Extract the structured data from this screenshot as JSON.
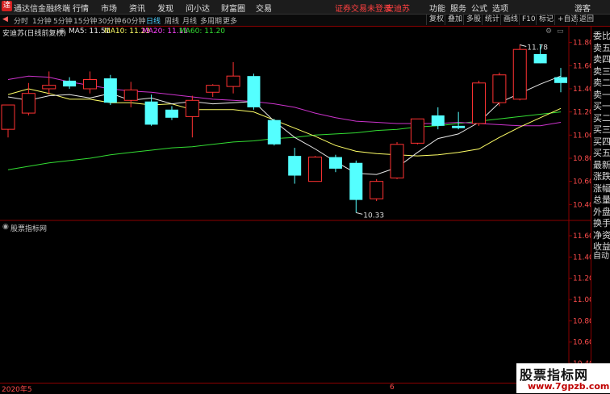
{
  "titlebar": {
    "app_name": "通达信金融终端",
    "menus": [
      "行情",
      "市场",
      "资讯",
      "发现",
      "问小达",
      "财富圈",
      "交易"
    ],
    "notice": "证券交易未登录",
    "stock_link": "安迪苏",
    "right": [
      "功能",
      "服务",
      "公式",
      "选项"
    ],
    "guest": "游客"
  },
  "toolbar": {
    "periods": [
      "分时",
      "1分钟",
      "5分钟",
      "15分钟",
      "30分钟",
      "60分钟",
      "日线",
      "周线",
      "月线",
      "多周期",
      "更多"
    ],
    "active_period": "日线",
    "buttons": [
      "复权",
      "叠加",
      "多股",
      "统计",
      "画线",
      "F10",
      "标记",
      "+自选",
      "返回"
    ]
  },
  "chart_title": "安迪苏(日线前复权)",
  "ma_legend": [
    {
      "label": "MA5: 11.51",
      "color": "#e8e8e8"
    },
    {
      "label": "MA10: 11.23",
      "color": "#ffff66"
    },
    {
      "label": "MA20: 11.11",
      "color": "#ff44ff"
    },
    {
      "label": "MA60: 11.20",
      "color": "#33dd33"
    }
  ],
  "indicator_title": "股票指标网",
  "annotations": {
    "high": "11.78",
    "low": "10.33"
  },
  "bottom": {
    "date_start": "2020年5",
    "date_mid": "6"
  },
  "right_panel": [
    "委比",
    "卖五",
    "卖四",
    "卖三",
    "卖二",
    "卖一",
    "买一",
    "买二",
    "买三",
    "买四",
    "买五",
    "最新",
    "涨跌",
    "涨幅",
    "总量",
    "外盘",
    "换手",
    "净资",
    "收益"
  ],
  "right_panel_footer": "自动",
  "watermark": {
    "title": "股票指标网",
    "url": "www.7gpzb.com"
  },
  "colors": {
    "up": "#ff3232",
    "down": "#54ffff",
    "ma5": "#e8e8e8",
    "ma10": "#ffff66",
    "ma20": "#cc33cc",
    "ma60": "#33dd33",
    "grid": "#8b0000",
    "axis_text": "#ff4d4d"
  },
  "chart_data": {
    "type": "candlestick",
    "y_axis_main": {
      "ticks": [
        11.8,
        11.6,
        11.4,
        11.2,
        11.0,
        10.8,
        10.6,
        10.4
      ],
      "ylim": [
        10.27,
        11.86
      ]
    },
    "y_axis_indicator": {
      "ticks": [
        11.6,
        11.4,
        11.2,
        11.0,
        10.8,
        10.6,
        10.4
      ]
    },
    "candles": [
      {
        "open": 11.05,
        "high": 11.22,
        "low": 10.98,
        "close": 11.26
      },
      {
        "open": 11.19,
        "high": 11.45,
        "low": 11.17,
        "close": 11.36
      },
      {
        "open": 11.4,
        "high": 11.55,
        "low": 11.35,
        "close": 11.43
      },
      {
        "open": 11.47,
        "high": 11.5,
        "low": 11.4,
        "close": 11.42
      },
      {
        "open": 11.4,
        "high": 11.55,
        "low": 11.36,
        "close": 11.48
      },
      {
        "open": 11.49,
        "high": 11.52,
        "low": 11.26,
        "close": 11.28
      },
      {
        "open": 11.3,
        "high": 11.46,
        "low": 11.24,
        "close": 11.39
      },
      {
        "open": 11.29,
        "high": 11.35,
        "low": 11.08,
        "close": 11.09
      },
      {
        "open": 11.22,
        "high": 11.25,
        "low": 11.13,
        "close": 11.15
      },
      {
        "open": 11.16,
        "high": 11.34,
        "low": 10.98,
        "close": 11.3
      },
      {
        "open": 11.37,
        "high": 11.44,
        "low": 11.33,
        "close": 11.43
      },
      {
        "open": 11.42,
        "high": 11.63,
        "low": 11.36,
        "close": 11.51
      },
      {
        "open": 11.51,
        "high": 11.53,
        "low": 11.22,
        "close": 11.24
      },
      {
        "open": 11.13,
        "high": 11.14,
        "low": 10.91,
        "close": 10.92
      },
      {
        "open": 10.82,
        "high": 10.89,
        "low": 10.58,
        "close": 10.65
      },
      {
        "open": 10.6,
        "high": 10.82,
        "low": 10.6,
        "close": 10.81
      },
      {
        "open": 10.81,
        "high": 10.83,
        "low": 10.68,
        "close": 10.71
      },
      {
        "open": 10.76,
        "high": 10.78,
        "low": 10.33,
        "close": 10.44
      },
      {
        "open": 10.45,
        "high": 10.62,
        "low": 10.43,
        "close": 10.6
      },
      {
        "open": 10.63,
        "high": 10.94,
        "low": 10.62,
        "close": 10.92
      },
      {
        "open": 10.93,
        "high": 11.11,
        "low": 10.92,
        "close": 11.14
      },
      {
        "open": 11.17,
        "high": 11.24,
        "low": 11.05,
        "close": 11.08
      },
      {
        "open": 11.08,
        "high": 11.2,
        "low": 11.05,
        "close": 11.06
      },
      {
        "open": 11.1,
        "high": 11.47,
        "low": 11.08,
        "close": 11.45
      },
      {
        "open": 11.28,
        "high": 11.54,
        "low": 11.25,
        "close": 11.52
      },
      {
        "open": 11.31,
        "high": 11.78,
        "low": 11.3,
        "close": 11.74
      },
      {
        "open": 11.7,
        "high": 11.78,
        "low": 11.62,
        "close": 11.62
      },
      {
        "open": 11.5,
        "high": 11.58,
        "low": 11.37,
        "close": 11.45
      }
    ],
    "ma5": [
      11.33,
      11.3,
      11.34,
      11.35,
      11.32,
      11.36,
      11.3,
      11.32,
      11.27,
      11.29,
      11.27,
      11.28,
      11.29,
      11.12,
      10.98,
      10.88,
      10.77,
      10.67,
      10.66,
      10.72,
      10.85,
      10.97,
      11.01,
      11.11,
      11.28,
      11.36,
      11.44,
      11.51
    ],
    "ma10": [
      11.35,
      11.4,
      11.36,
      11.31,
      11.31,
      11.28,
      11.28,
      11.26,
      11.27,
      11.22,
      11.22,
      11.22,
      11.2,
      11.13,
      11.06,
      10.99,
      10.91,
      10.86,
      10.84,
      10.83,
      10.82,
      10.83,
      10.85,
      10.88,
      10.98,
      11.07,
      11.15,
      11.23
    ],
    "ma20": [
      11.48,
      11.51,
      11.5,
      11.46,
      11.43,
      11.4,
      11.38,
      11.37,
      11.35,
      11.33,
      11.31,
      11.3,
      11.29,
      11.27,
      11.24,
      11.19,
      11.15,
      11.12,
      11.11,
      11.1,
      11.1,
      11.1,
      11.11,
      11.1,
      11.09,
      11.08,
      11.08,
      11.11
    ],
    "ma60": [
      10.7,
      10.73,
      10.76,
      10.78,
      10.8,
      10.83,
      10.85,
      10.87,
      10.89,
      10.9,
      10.92,
      10.94,
      10.95,
      10.97,
      10.98,
      11.0,
      11.01,
      11.02,
      11.04,
      11.05,
      11.07,
      11.08,
      11.1,
      11.12,
      11.14,
      11.16,
      11.18,
      11.2
    ]
  }
}
